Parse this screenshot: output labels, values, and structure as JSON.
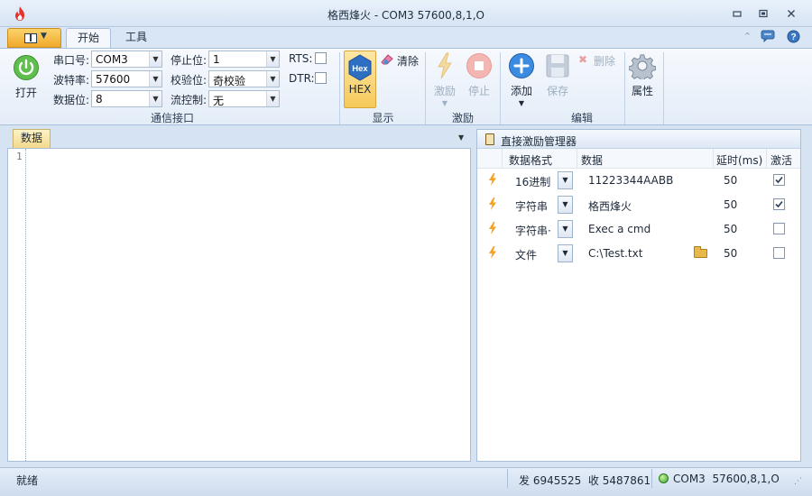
{
  "window": {
    "title": "格西烽火 - COM3  57600,8,1,O",
    "minimize_glyph": "▭",
    "restore_glyph": "▣",
    "close_glyph": "✕"
  },
  "ribbon_tabs": [
    {
      "label": "开始",
      "active": true
    },
    {
      "label": "工具",
      "active": false
    }
  ],
  "ribbon": {
    "open_label": "打开",
    "comm": {
      "group_label": "通信接口",
      "port_label": "串口号:",
      "port_value": "COM3",
      "baud_label": "波特率:",
      "baud_value": "57600",
      "databits_label": "数据位:",
      "databits_value": "8",
      "stopbits_label": "停止位:",
      "stopbits_value": "1",
      "parity_label": "校验位:",
      "parity_value": "奇校验",
      "flow_label": "流控制:",
      "flow_value": "无",
      "rts_label": "RTS:",
      "dtr_label": "DTR:"
    },
    "display": {
      "group_label": "显示",
      "hex_icon_text": "Hex",
      "hex_label": "HEX",
      "clear_label": "清除"
    },
    "stimulus": {
      "group_label": "激励",
      "stimulus_label": "激励",
      "stop_label": "停止"
    },
    "edit": {
      "group_label": "编辑",
      "add_label": "添加",
      "save_label": "保存",
      "delete_label": "删除",
      "properties_label": "属性"
    }
  },
  "data_pane": {
    "tab_label": "数据",
    "line_numbers": [
      "1"
    ]
  },
  "stimulus_manager": {
    "title": "直接激励管理器",
    "columns": [
      "数据格式",
      "数据",
      "延时(ms)",
      "激活"
    ],
    "rows": [
      {
        "format": "16进制",
        "data": "11223344AABB",
        "delay": "50",
        "active": true,
        "has_folder": false
      },
      {
        "format": "字符串",
        "data": "格西烽火",
        "delay": "50",
        "active": true,
        "has_folder": false
      },
      {
        "format": "字符串·",
        "data": "Exec a cmd",
        "delay": "50",
        "active": false,
        "has_folder": false
      },
      {
        "format": "文件",
        "data": "C:\\Test.txt",
        "delay": "50",
        "active": false,
        "has_folder": true
      }
    ]
  },
  "statusbar": {
    "ready": "就绪",
    "counts": "发 6945525  收 5487861",
    "port_status": "COM3  57600,8,1,O"
  },
  "colors": {
    "accent_blue": "#3a7bd5",
    "power_green": "#58b84a",
    "stop_red": "#e8504a",
    "bolt_orange": "#f4a020"
  }
}
